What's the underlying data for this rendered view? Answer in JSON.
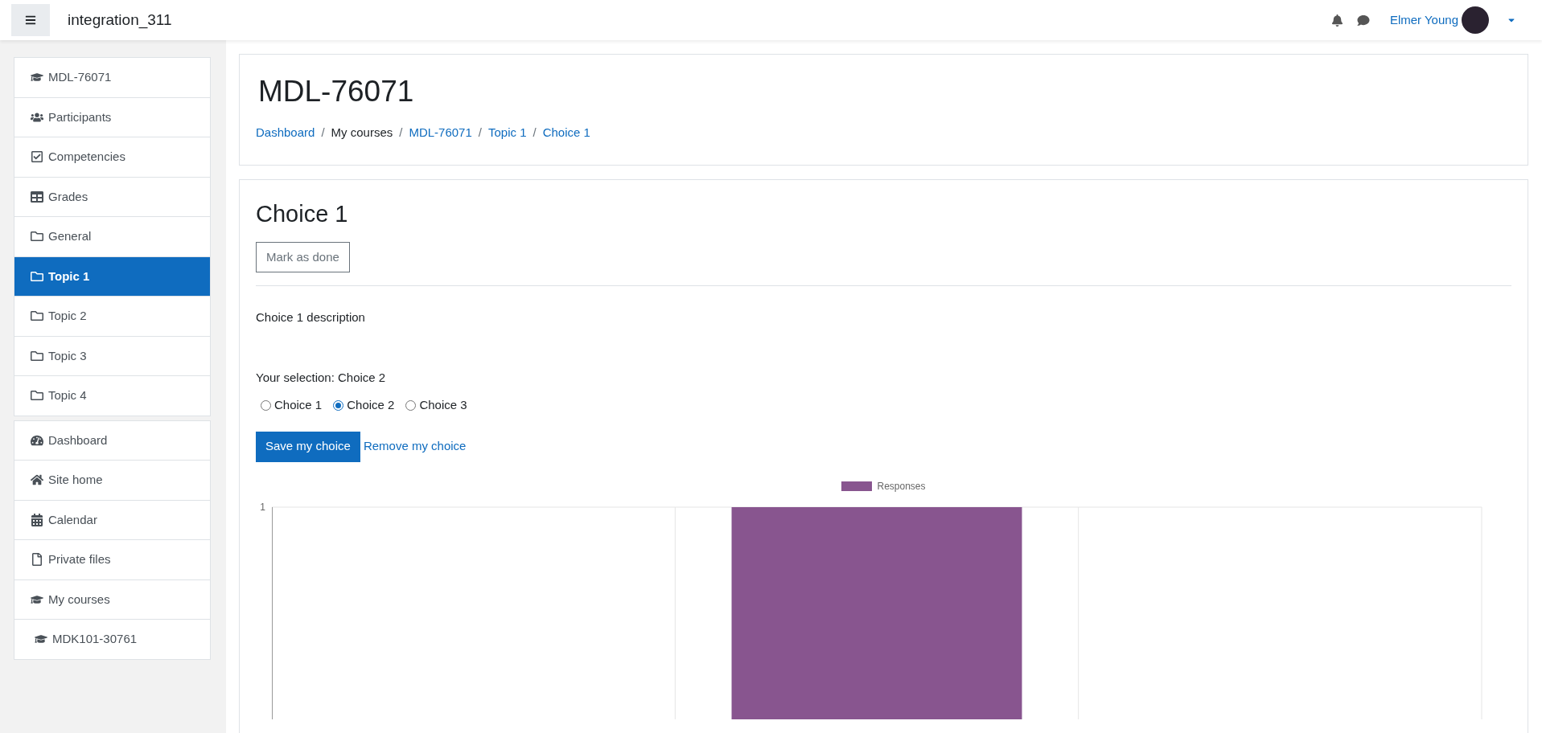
{
  "navbar": {
    "site_name": "integration_311",
    "user_name": "Elmer Young"
  },
  "sidebar": {
    "course_items": [
      {
        "label": "MDL-76071",
        "selected": false
      },
      {
        "label": "Participants",
        "selected": false
      },
      {
        "label": "Competencies",
        "selected": false
      },
      {
        "label": "Grades",
        "selected": false
      },
      {
        "label": "General",
        "selected": false
      },
      {
        "label": "Topic 1",
        "selected": true
      },
      {
        "label": "Topic 2",
        "selected": false
      },
      {
        "label": "Topic 3",
        "selected": false
      },
      {
        "label": "Topic 4",
        "selected": false
      }
    ],
    "site_items": [
      {
        "label": "Dashboard",
        "selected": false
      },
      {
        "label": "Site home",
        "selected": false
      },
      {
        "label": "Calendar",
        "selected": false
      },
      {
        "label": "Private files",
        "selected": false
      },
      {
        "label": "My courses",
        "selected": false,
        "children": [
          {
            "label": "MDK101-30761",
            "selected": false
          }
        ]
      }
    ]
  },
  "page_header": {
    "title": "MDL-76071",
    "breadcrumb": [
      {
        "label": "Dashboard",
        "kind": "link"
      },
      {
        "label": "/",
        "kind": "separator"
      },
      {
        "label": "My courses",
        "kind": "text"
      },
      {
        "label": "/",
        "kind": "separator"
      },
      {
        "label": "MDL-76071",
        "kind": "link"
      },
      {
        "label": "/",
        "kind": "separator"
      },
      {
        "label": "Topic 1",
        "kind": "link"
      },
      {
        "label": "/",
        "kind": "separator"
      },
      {
        "label": "Choice 1",
        "kind": "link"
      }
    ]
  },
  "activity": {
    "title": "Choice 1",
    "mark_button": "Mark as done",
    "description": "Choice 1 description",
    "selection_text": "Your selection: Choice 2",
    "options": [
      {
        "label": "Choice 1",
        "selected": false
      },
      {
        "label": "Choice 2",
        "selected": true
      },
      {
        "label": "Choice 3",
        "selected": false
      }
    ],
    "save_button": "Save my choice",
    "remove_link": "Remove my choice",
    "chart": {
      "legend": "Responses",
      "y_tick": "1"
    }
  }
}
